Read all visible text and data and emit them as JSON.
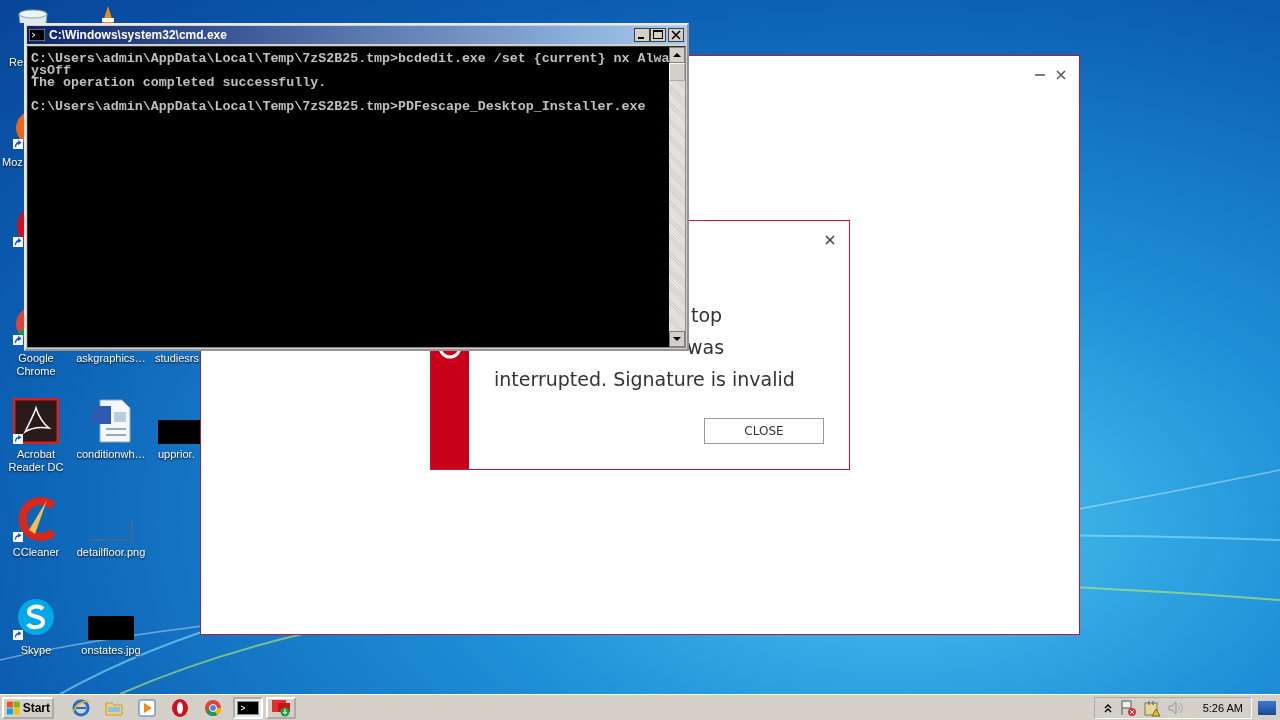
{
  "desktop_icons": [
    {
      "kind": "recycle",
      "label": "Re"
    },
    {
      "kind": "cone"
    },
    {
      "kind": "firefox",
      "label": "Moz"
    },
    {
      "kind": "opera"
    },
    {
      "kind": "chrome",
      "label": "Google Chrome"
    },
    {
      "kind": "hidden",
      "label": "askgraphics…"
    },
    {
      "kind": "hidden",
      "label": "studiesrs"
    },
    {
      "kind": "acrobat",
      "label": "Acrobat Reader DC"
    },
    {
      "kind": "word",
      "label": "conditionwh…"
    },
    {
      "kind": "black",
      "label": "upprior."
    },
    {
      "kind": "ccleaner",
      "label": "CCleaner"
    },
    {
      "kind": "blank",
      "label": "detailfloor.png"
    },
    {
      "kind": "skype",
      "label": "Skype"
    },
    {
      "kind": "black",
      "label": "onstates.jpg"
    }
  ],
  "installer_window": {
    "dialog": {
      "message_lines": [
        "top",
        "was",
        "interrupted. Signature is invalid"
      ],
      "button": "CLOSE"
    }
  },
  "console_window": {
    "title": "C:\\Windows\\system32\\cmd.exe",
    "lines": [
      "C:\\Users\\admin\\AppData\\Local\\Temp\\7zS2B25.tmp>bcdedit.exe /set {current} nx Alwa",
      "ysOff",
      "The operation completed successfully.",
      "C:\\Users\\admin\\AppData\\Local\\Temp\\7zS2B25.tmp>PDFescape_Desktop_Installer.exe"
    ]
  },
  "taskbar": {
    "start": "Start",
    "quick_launch": [
      {
        "kind": "ie"
      },
      {
        "kind": "folder"
      },
      {
        "kind": "media"
      },
      {
        "kind": "opera"
      },
      {
        "kind": "chrome"
      }
    ],
    "tasks": [
      {
        "kind": "cmd",
        "selected": true
      },
      {
        "kind": "installer",
        "selected": false
      }
    ],
    "tray": {
      "time": "5:26 AM"
    }
  }
}
